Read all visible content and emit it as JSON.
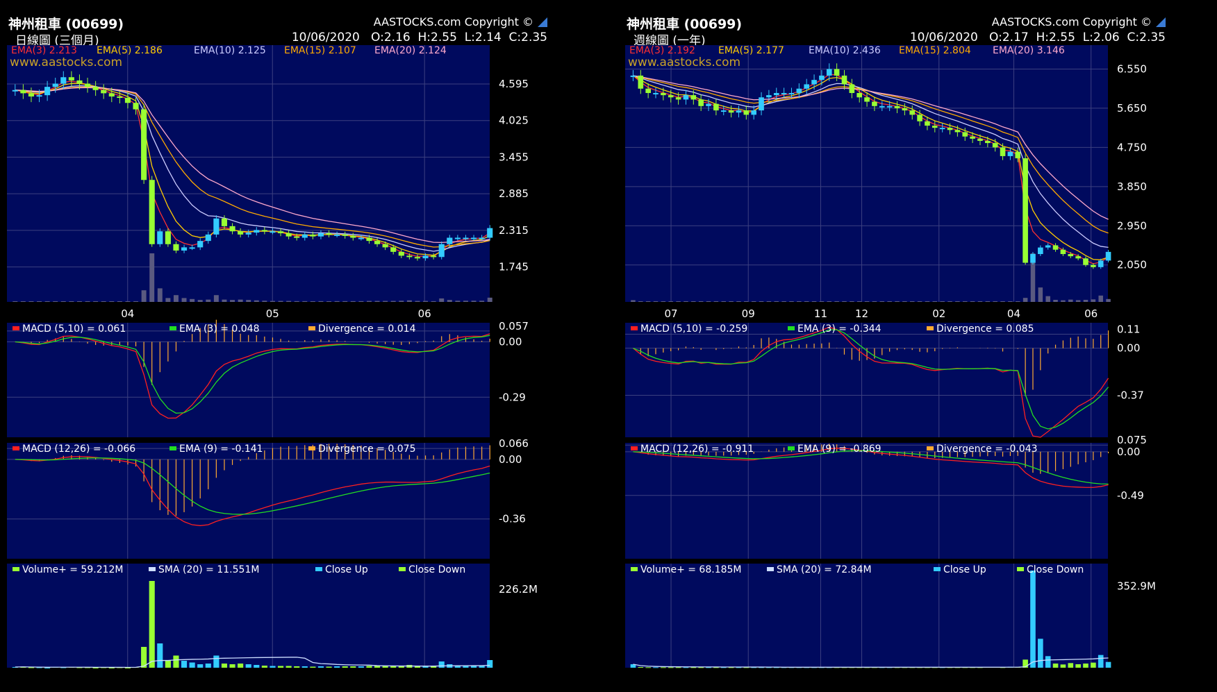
{
  "colors": {
    "plot_bg": "#000a5e",
    "grid": "#3c4080",
    "up": "#33ccff",
    "down": "#99ff33",
    "macd": "#ff2020",
    "signal": "#22dd22",
    "divergence": "#ffaa33",
    "volume_sma": "#ccddff",
    "ema": [
      "#ff3030",
      "#ffcc00",
      "#ccccff",
      "#ffaa00",
      "#ffaacc"
    ]
  },
  "panels": [
    {
      "title": "神州租車 (00699)",
      "copyright": "AASTOCKS.com Copyright ©",
      "subtitle": "日線圖 (三個月)",
      "ohlc": "10/06/2020   O:2.16  H:2.55  L:2.14  C:2.35",
      "watermark": "www.aastocks.com",
      "x_labels": [
        {
          "label": "04",
          "pos": 0.25
        },
        {
          "label": "05",
          "pos": 0.55
        },
        {
          "label": "06",
          "pos": 0.865
        }
      ],
      "price": {
        "ylim": [
          1.2,
          5.2
        ],
        "ticks": [
          "4.595",
          "4.025",
          "3.455",
          "2.885",
          "2.315",
          "1.745"
        ],
        "legend": [
          "EMA(3) 2.213",
          "EMA(5) 2.186",
          "EMA(10) 2.125",
          "EMA(15) 2.107",
          "EMA(20) 2.124"
        ]
      },
      "macd1": {
        "legend": [
          "MACD (5,10) = 0.061",
          "EMA (3) = 0.048",
          "Divergence = 0.014"
        ],
        "ticks": [
          "0.057",
          "0.00",
          "-0.29"
        ],
        "ylim": [
          -0.5,
          0.1
        ]
      },
      "macd2": {
        "legend": [
          "MACD (12,26) = -0.066",
          "EMA (9) = -0.141",
          "Divergence = 0.075"
        ],
        "ticks": [
          "0.066",
          "0.00",
          "-0.36"
        ],
        "ylim": [
          -0.6,
          0.1
        ]
      },
      "volume": {
        "legend": [
          "Volume+  = 59.212M",
          "SMA (20)  = 11.551M",
          "Close Up",
          "Close Down"
        ],
        "ticks": [
          "226.2M"
        ],
        "ymax": 300
      }
    },
    {
      "title": "神州租車 (00699)",
      "copyright": "AASTOCKS.com Copyright ©",
      "subtitle": "週線圖 (一年)",
      "ohlc": "10/06/2020   O:2.17  H:2.55  L:2.06  C:2.35",
      "watermark": "www.aastocks.com",
      "x_labels": [
        {
          "label": "07",
          "pos": 0.095
        },
        {
          "label": "09",
          "pos": 0.255
        },
        {
          "label": "11",
          "pos": 0.405
        },
        {
          "label": "12",
          "pos": 0.49
        },
        {
          "label": "02",
          "pos": 0.65
        },
        {
          "label": "04",
          "pos": 0.805
        },
        {
          "label": "06",
          "pos": 0.965
        }
      ],
      "price": {
        "ylim": [
          1.2,
          7.1
        ],
        "ticks": [
          "6.550",
          "5.650",
          "4.750",
          "3.850",
          "2.950",
          "2.050"
        ],
        "legend": [
          "EMA(3) 2.192",
          "EMA(5) 2.177",
          "EMA(10) 2.436",
          "EMA(15) 2.804",
          "EMA(20) 3.146"
        ]
      },
      "macd1": {
        "legend": [
          "MACD (5,10) = -0.259",
          "EMA (3) = -0.344",
          "Divergence = 0.085"
        ],
        "ticks": [
          "0.11",
          "0.00",
          "-0.37"
        ],
        "ylim": [
          -0.7,
          0.2
        ]
      },
      "macd2": {
        "legend": [
          "MACD (12,26) = -0.911",
          "EMA (9) = -0.869",
          "Divergence = -0.043"
        ],
        "ticks": [
          "0.075",
          "0.00",
          "-0.49"
        ],
        "ylim": [
          -1.2,
          0.1
        ]
      },
      "volume": {
        "legend": [
          "Volume+  = 68.185M",
          "SMA (20)  = 72.84M",
          "Close Up",
          "Close Down"
        ],
        "ticks": [
          "352.9M"
        ],
        "ymax": 450
      }
    }
  ],
  "chart_data": [
    {
      "type": "candlestick",
      "title": "神州租車 (00699) 日線圖 (三個月)",
      "x_labels": [
        "04",
        "05",
        "06"
      ],
      "close": [
        4.5,
        4.45,
        4.4,
        4.42,
        4.55,
        4.6,
        4.7,
        4.65,
        4.6,
        4.55,
        4.5,
        4.45,
        4.4,
        4.38,
        4.3,
        4.2,
        3.1,
        2.1,
        2.3,
        2.1,
        2.0,
        2.05,
        2.05,
        2.15,
        2.25,
        2.5,
        2.38,
        2.3,
        2.25,
        2.28,
        2.32,
        2.3,
        2.3,
        2.27,
        2.22,
        2.2,
        2.25,
        2.22,
        2.27,
        2.25,
        2.25,
        2.23,
        2.2,
        2.2,
        2.15,
        2.1,
        2.05,
        1.98,
        1.92,
        1.9,
        1.88,
        1.92,
        1.9,
        2.1,
        2.2,
        2.2,
        2.2,
        2.2,
        2.2,
        2.35
      ],
      "volume": [
        2,
        3,
        1,
        1,
        0,
        2,
        1,
        2,
        1,
        1,
        0,
        1,
        0,
        1,
        0,
        2,
        60,
        250,
        70,
        20,
        35,
        20,
        15,
        10,
        12,
        35,
        12,
        10,
        12,
        10,
        8,
        6,
        5,
        5,
        5,
        4,
        4,
        3,
        4,
        3,
        4,
        4,
        4,
        4,
        5,
        5,
        5,
        5,
        6,
        8,
        5,
        5,
        4,
        18,
        10,
        6,
        6,
        6,
        6,
        22
      ],
      "ylim": [
        1.2,
        5.2
      ],
      "series_end": {
        "EMA(3)": 2.213,
        "EMA(5)": 2.186,
        "EMA(10)": 2.125,
        "EMA(15)": 2.107,
        "EMA(20)": 2.124
      },
      "macd_5_10": 0.061,
      "ema_3": 0.048,
      "divergence_1": 0.014,
      "macd_12_26": -0.066,
      "ema_9": -0.141,
      "divergence_2": 0.075,
      "volume_plus": "59.212M",
      "sma_20": "11.551M"
    },
    {
      "type": "candlestick",
      "title": "神州租車 (00699) 週線圖 (一年)",
      "x_labels": [
        "07",
        "09",
        "11",
        "12",
        "02",
        "04",
        "06"
      ],
      "close": [
        6.4,
        6.1,
        6.0,
        6.0,
        5.95,
        5.9,
        5.85,
        5.95,
        5.85,
        5.7,
        5.75,
        5.6,
        5.6,
        5.55,
        5.6,
        5.5,
        5.6,
        5.9,
        5.95,
        6.0,
        6.0,
        6.0,
        6.1,
        6.2,
        6.3,
        6.4,
        6.55,
        6.4,
        6.2,
        6.0,
        5.9,
        5.8,
        5.7,
        5.7,
        5.7,
        5.65,
        5.6,
        5.5,
        5.35,
        5.25,
        5.2,
        5.2,
        5.15,
        5.1,
        5.0,
        4.95,
        4.9,
        4.85,
        4.75,
        4.55,
        4.65,
        4.5,
        2.1,
        2.3,
        2.45,
        2.5,
        2.4,
        2.3,
        2.25,
        2.2,
        2.05,
        2.0,
        2.15,
        2.35
      ],
      "volume": [
        15,
        3,
        2,
        2,
        2,
        2,
        2,
        2,
        2,
        2,
        2,
        2,
        2,
        2,
        2,
        2,
        2,
        2,
        2,
        2,
        2,
        2,
        2,
        2,
        2,
        2,
        2,
        2,
        2,
        2,
        2,
        2,
        2,
        2,
        2,
        2,
        2,
        2,
        2,
        2,
        2,
        2,
        2,
        2,
        2,
        2,
        2,
        3,
        3,
        2,
        4,
        3,
        35,
        420,
        125,
        50,
        18,
        14,
        20,
        15,
        18,
        22,
        55,
        25
      ],
      "ylim": [
        1.2,
        7.1
      ],
      "series_end": {
        "EMA(3)": 2.192,
        "EMA(5)": 2.177,
        "EMA(10)": 2.436,
        "EMA(15)": 2.804,
        "EMA(20)": 3.146
      },
      "macd_5_10": -0.259,
      "ema_3": -0.344,
      "divergence_1": 0.085,
      "macd_12_26": -0.911,
      "ema_9": -0.869,
      "divergence_2": -0.043,
      "volume_plus": "68.185M",
      "sma_20": "72.84M"
    }
  ]
}
